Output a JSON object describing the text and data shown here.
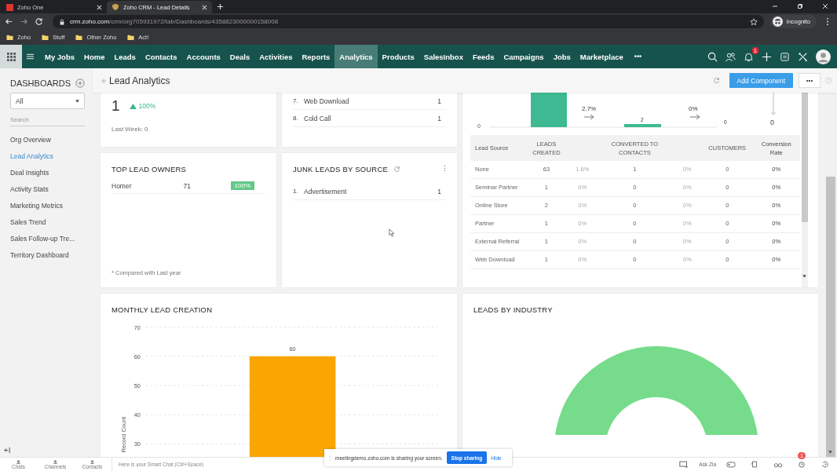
{
  "browser": {
    "tabs": [
      {
        "title": "Zoho One",
        "selected": false
      },
      {
        "title": "Zoho CRM - Lead Details",
        "selected": true
      }
    ],
    "url_host": "crm.zoho.com",
    "url_path": "/crm/org705931972/tab/Dashboards/4358823000000158008",
    "profile": "Incognito",
    "bookmarks": [
      "Zoho",
      "Stuff",
      "Other Zoho",
      "Act!"
    ]
  },
  "nav": {
    "items": [
      {
        "label": "My Jobs",
        "selected": false
      },
      {
        "label": "Home",
        "selected": false
      },
      {
        "label": "Leads",
        "selected": false
      },
      {
        "label": "Contacts",
        "selected": false
      },
      {
        "label": "Accounts",
        "selected": false
      },
      {
        "label": "Deals",
        "selected": false
      },
      {
        "label": "Activities",
        "selected": false
      },
      {
        "label": "Reports",
        "selected": false
      },
      {
        "label": "Analytics",
        "selected": true
      },
      {
        "label": "Products",
        "selected": false
      },
      {
        "label": "SalesInbox",
        "selected": false
      },
      {
        "label": "Feeds",
        "selected": false
      },
      {
        "label": "Campaigns",
        "selected": false
      },
      {
        "label": "Jobs",
        "selected": false
      },
      {
        "label": "Marketplace",
        "selected": false
      }
    ],
    "more": "•••",
    "notification_count": "1"
  },
  "sidebar": {
    "title": "DASHBOARDS",
    "filter": "All",
    "search_placeholder": "Search",
    "items": [
      {
        "label": "Org Overview",
        "selected": false
      },
      {
        "label": "Lead Analytics",
        "selected": true
      },
      {
        "label": "Deal Insights",
        "selected": false
      },
      {
        "label": "Activity Stats",
        "selected": false
      },
      {
        "label": "Marketing Metrics",
        "selected": false
      },
      {
        "label": "Sales Trend",
        "selected": false
      },
      {
        "label": "Sales Follow-up Tre...",
        "selected": false
      },
      {
        "label": "Territory Dashboard",
        "selected": false
      }
    ]
  },
  "header": {
    "title": "Lead Analytics",
    "add_button": "Add Component",
    "more_button": "•••"
  },
  "lead_count": {
    "value": "1",
    "change": "100%",
    "last_week": "Last Week: 0"
  },
  "source_list": {
    "items": [
      {
        "index": "7.",
        "label": "Web Download",
        "count": "1"
      },
      {
        "index": "8.",
        "label": "Cold Call",
        "count": "1"
      }
    ]
  },
  "top_lead_owners": {
    "title": "TOP LEAD OWNERS",
    "rows": [
      {
        "name": "Homer",
        "count": "71",
        "share": "100%"
      }
    ],
    "footnote": "* Compared with Last year"
  },
  "junk_leads": {
    "title": "JUNK LEADS BY SOURCE",
    "items": [
      {
        "index": "1.",
        "label": "Advertisement",
        "count": "1"
      }
    ]
  },
  "funnel": {
    "axis_label": "0",
    "rates": [
      "2.7%",
      "0%"
    ],
    "stage_labels": [
      "2",
      "0"
    ],
    "end_value": "0"
  },
  "conversion_table": {
    "columns": [
      {
        "label": "Lead Source"
      },
      {
        "label": "LEADS CREATED"
      },
      {},
      {
        "label": "CONVERTED TO CONTACTS"
      },
      {},
      {
        "label": "CUSTOMERS"
      },
      {
        "label": "Conversion Rate"
      }
    ],
    "rows": [
      [
        "None",
        "63",
        "1.6%",
        "1",
        "0%",
        "0",
        "0%"
      ],
      [
        "Seminar Partner",
        "1",
        "0%",
        "0",
        "0%",
        "0",
        "0%"
      ],
      [
        "Online Store",
        "2",
        "0%",
        "0",
        "0%",
        "0",
        "0%"
      ],
      [
        "Partner",
        "1",
        "0%",
        "0",
        "0%",
        "0",
        "0%"
      ],
      [
        "External Referral",
        "1",
        "0%",
        "0",
        "0%",
        "0",
        "0%"
      ],
      [
        "Web Download",
        "1",
        "0%",
        "0",
        "0%",
        "0",
        "0%"
      ]
    ]
  },
  "monthly_lead_creation": {
    "title": "MONTHLY LEAD CREATION",
    "chart_data": {
      "type": "bar",
      "ylabel": "Record Count",
      "values": [
        60
      ],
      "ylim": [
        25,
        70
      ],
      "yticks": [
        30,
        40,
        50,
        60,
        70
      ],
      "grid": true,
      "data_labels": true
    }
  },
  "leads_by_industry": {
    "title": "LEADS BY INDUSTRY"
  },
  "bottom_bar": {
    "tabs": [
      "Chats",
      "Channels",
      "Contacts"
    ],
    "chat_placeholder": "Here is your Smart Chat (Ctrl+Space)",
    "ask_zia": "Ask Zia",
    "alarm_count": "1"
  },
  "share_banner": {
    "message": "meetingdemo.zoho.com is sharing your screen.",
    "stop_button": "Stop sharing",
    "hide_link": "Hide"
  }
}
